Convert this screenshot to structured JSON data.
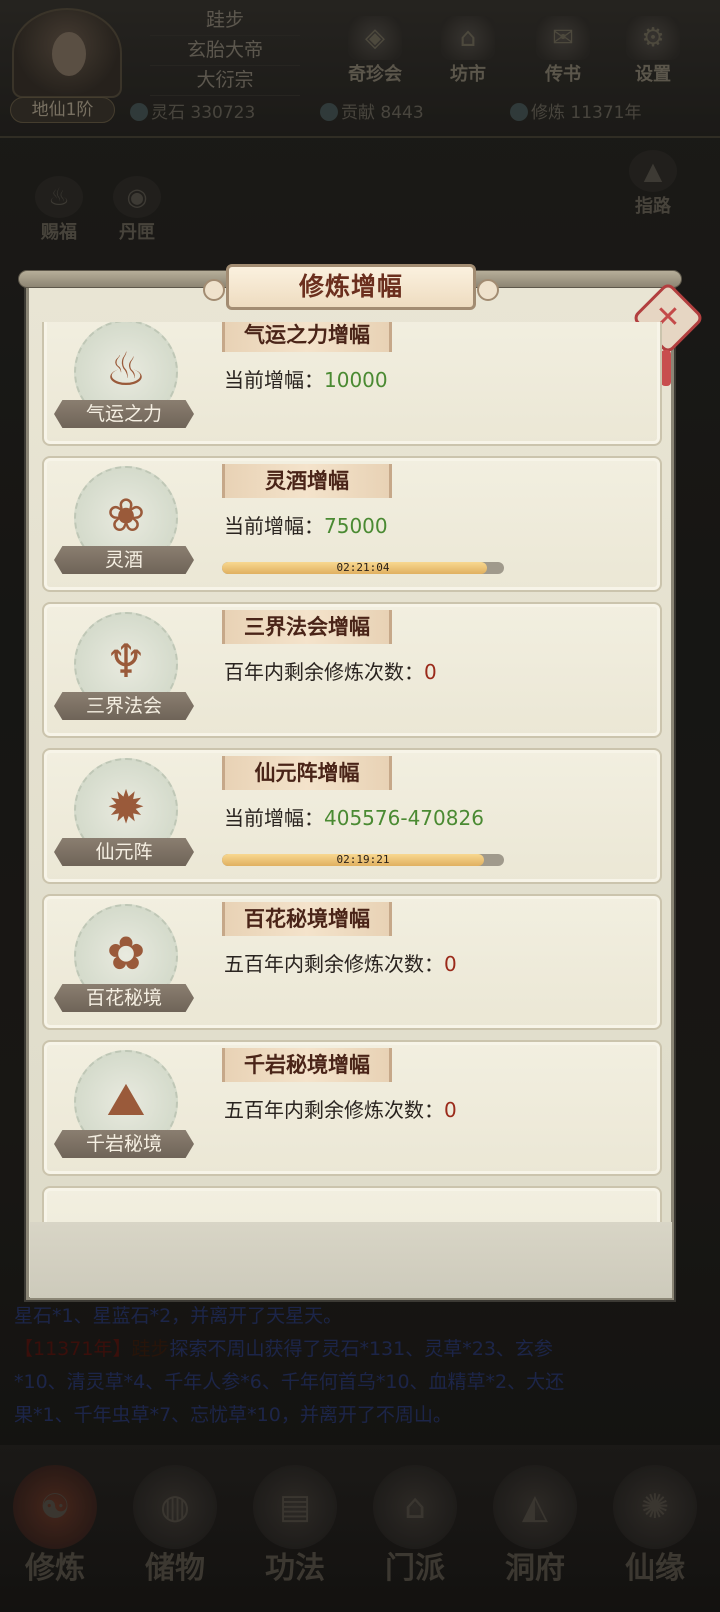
{
  "header": {
    "rank": "地仙1阶",
    "name_lines": [
      "跬步",
      "玄胎大帝",
      "大衍宗"
    ],
    "buttons": [
      {
        "label": "奇珍会",
        "icon": "treasure-icon"
      },
      {
        "label": "坊市",
        "icon": "market-icon"
      },
      {
        "label": "传书",
        "icon": "scroll-icon"
      },
      {
        "label": "设置",
        "icon": "gear-icon"
      }
    ],
    "stats": {
      "lingshi": "灵石 330723",
      "gongxian": "贡献 8443",
      "xiulian": "修炼 11371年"
    }
  },
  "side": {
    "left": [
      {
        "label": "赐福",
        "icon": "blessing-icon"
      },
      {
        "label": "丹匣",
        "icon": "pill-box-icon"
      }
    ],
    "right": [
      {
        "label": "指路",
        "icon": "guide-icon"
      }
    ]
  },
  "modal": {
    "title": "修炼增幅",
    "cards": [
      {
        "icon_label": "气运之力",
        "icon": "fortune-icon",
        "title": "气运之力增幅",
        "line_label": "当前增幅：",
        "line_value": "10000",
        "value_color": "green",
        "has_timer": false
      },
      {
        "icon_label": "灵酒",
        "icon": "wine-icon",
        "title": "灵酒增幅",
        "line_label": "当前增幅：",
        "line_value": "75000",
        "value_color": "green",
        "has_timer": true,
        "timer": "02:21:04",
        "progress": 0.94
      },
      {
        "icon_label": "三界法会",
        "icon": "incense-burner-icon",
        "title": "三界法会增幅",
        "line_label": "百年内剩余修炼次数：",
        "line_value": "0",
        "value_color": "red",
        "has_timer": false
      },
      {
        "icon_label": "仙元阵",
        "icon": "formation-icon",
        "title": "仙元阵增幅",
        "line_label": "当前增幅：",
        "line_value": "405576-470826",
        "value_color": "green",
        "has_timer": true,
        "timer": "02:19:21",
        "progress": 0.93
      },
      {
        "icon_label": "百花秘境",
        "icon": "flower-realm-icon",
        "title": "百花秘境增幅",
        "line_label": "五百年内剩余修炼次数：",
        "line_value": "0",
        "value_color": "red",
        "has_timer": false
      },
      {
        "icon_label": "千岩秘境",
        "icon": "rock-realm-icon",
        "title": "千岩秘境增幅",
        "line_label": "五百年内剩余修炼次数：",
        "line_value": "0",
        "value_color": "red",
        "has_timer": false
      }
    ]
  },
  "log": {
    "line1": "星石*1、星蓝石*2，并离开了天星天。",
    "line2_year": "【11371年】",
    "line2_name": "跬步",
    "line2_text": "探索不周山获得了灵石*131、灵草*23、玄参",
    "line3": "*10、清灵草*4、千年人参*6、千年何首乌*10、血精草*2、大还",
    "line4": "果*1、千年虫草*7、忘忧草*10，并离开了不周山。"
  },
  "nav": [
    {
      "label": "修炼",
      "icon": "meditate-icon"
    },
    {
      "label": "储物",
      "icon": "bag-icon"
    },
    {
      "label": "功法",
      "icon": "book-icon"
    },
    {
      "label": "门派",
      "icon": "temple-icon"
    },
    {
      "label": "洞府",
      "icon": "cave-icon"
    },
    {
      "label": "仙缘",
      "icon": "destiny-icon"
    }
  ],
  "colors": {
    "value_green": "#4a8a32",
    "value_red": "#9a2a1a",
    "title_red": "#6b2f1e"
  }
}
